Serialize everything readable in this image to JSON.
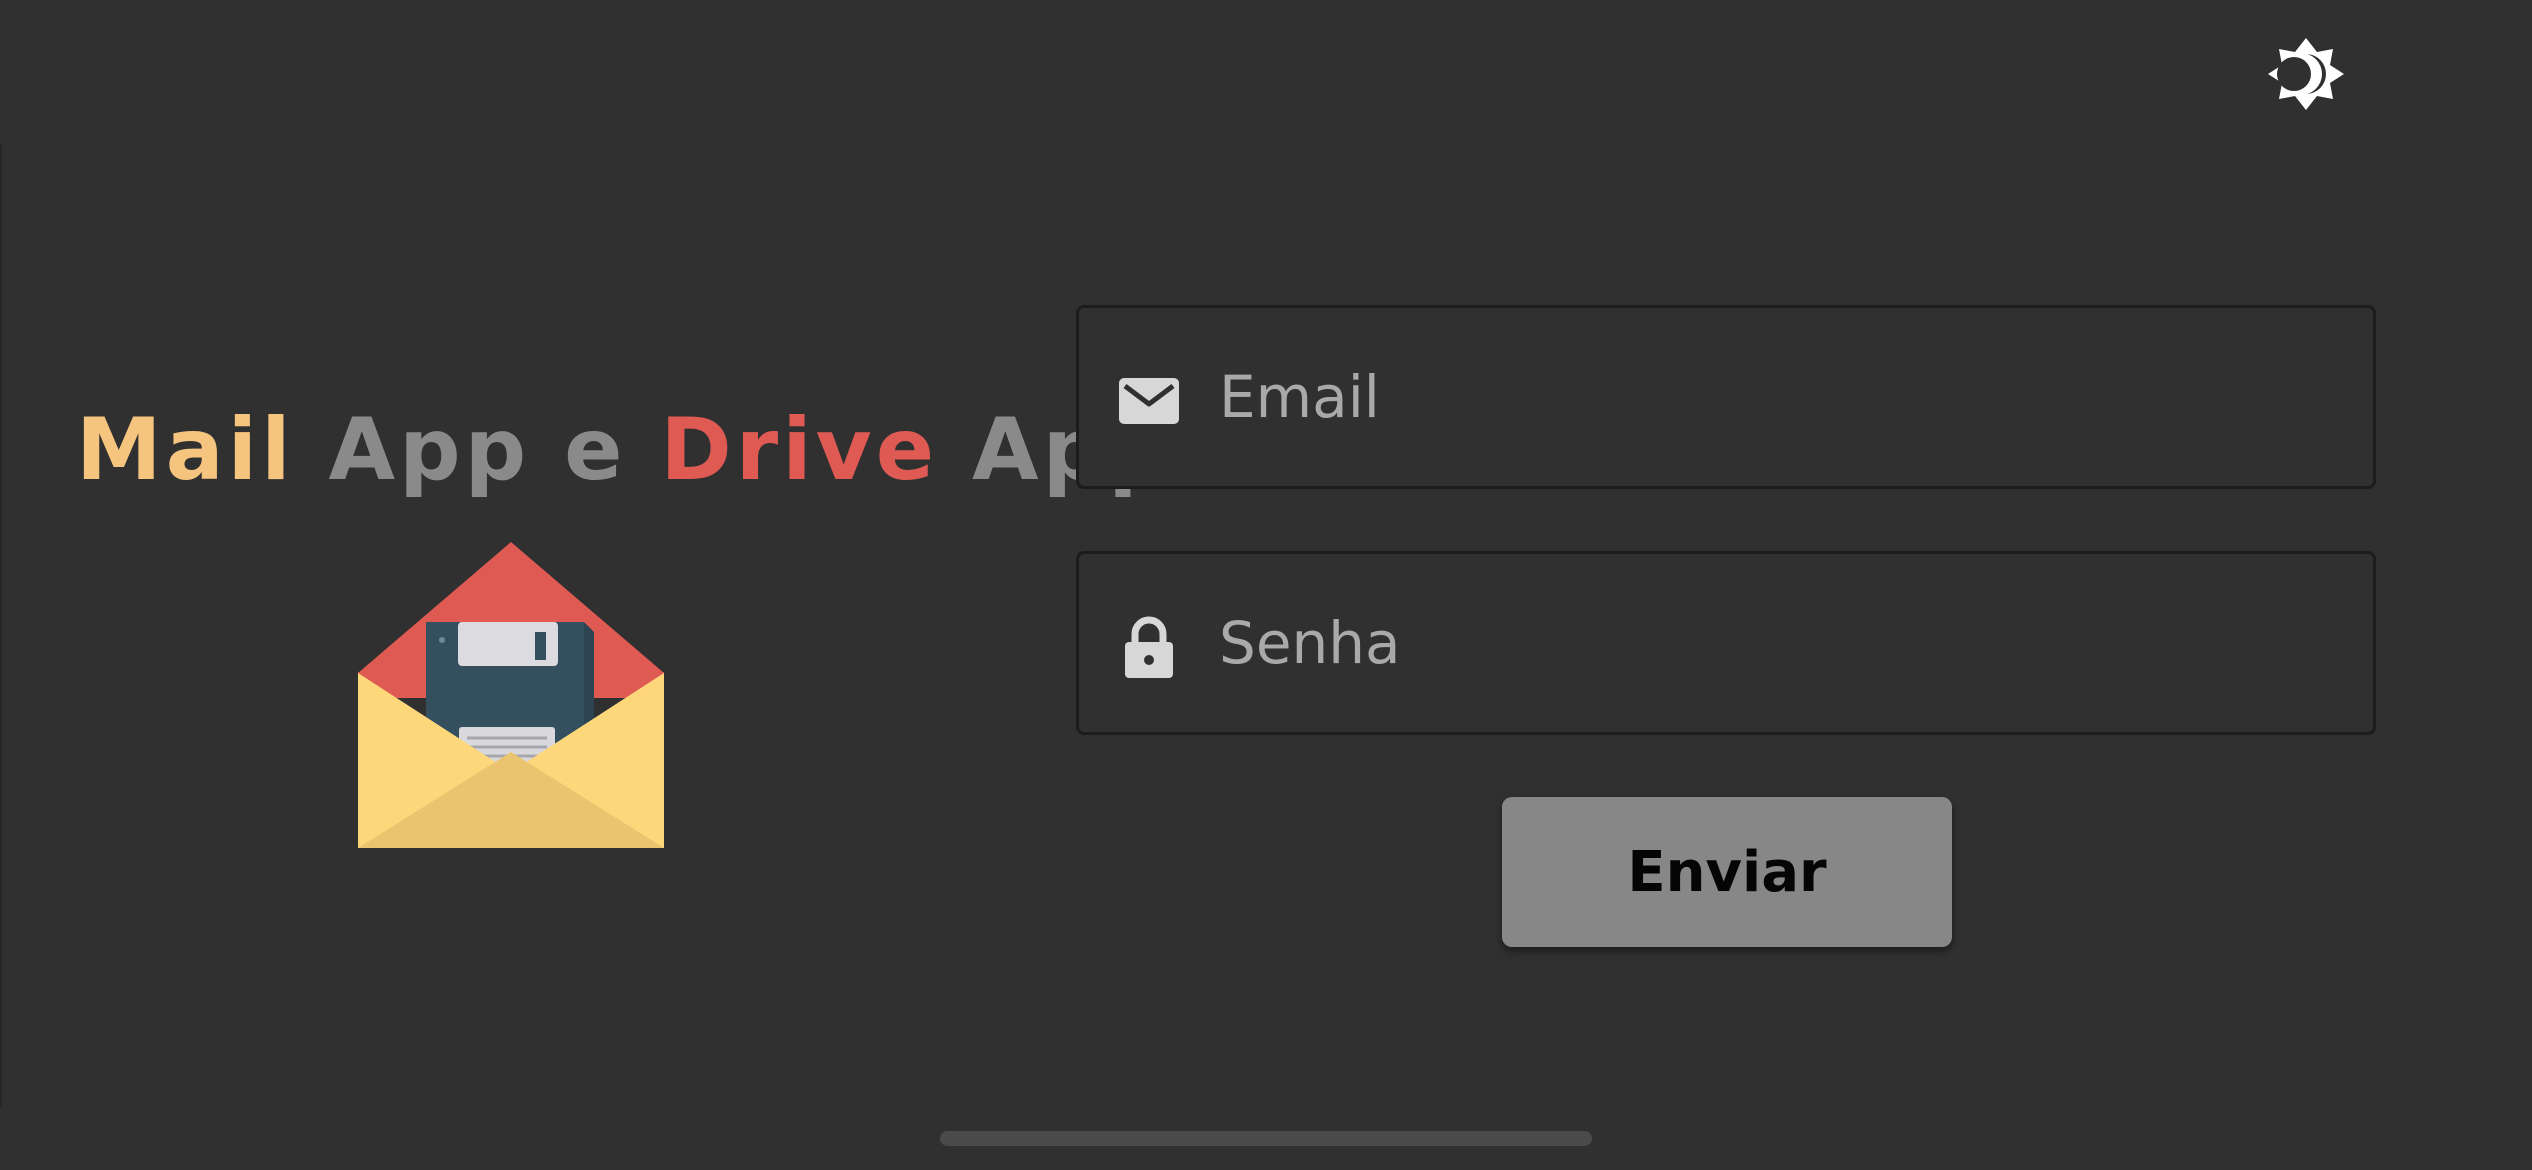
{
  "header": {
    "theme_toggle_icon": "brightness-moon-icon"
  },
  "brand": {
    "title_parts": [
      {
        "text": "Mail",
        "color": "#f5c47e"
      },
      {
        "text": " App e ",
        "color": "#8a8a8a"
      },
      {
        "text": "Drive",
        "color": "#e05a54"
      },
      {
        "text": " App",
        "color": "#8a8a8a"
      }
    ],
    "logo_icon": "envelope-floppy-disk-icon"
  },
  "login_form": {
    "email": {
      "icon": "envelope-icon",
      "value": "",
      "placeholder": "Email"
    },
    "password": {
      "icon": "lock-icon",
      "value": "",
      "placeholder": "Senha"
    },
    "submit_label": "Enviar"
  },
  "colors": {
    "background": "#303030",
    "field_border": "#1c1c1c",
    "button": "#878787",
    "placeholder": "#a9a9a9"
  }
}
